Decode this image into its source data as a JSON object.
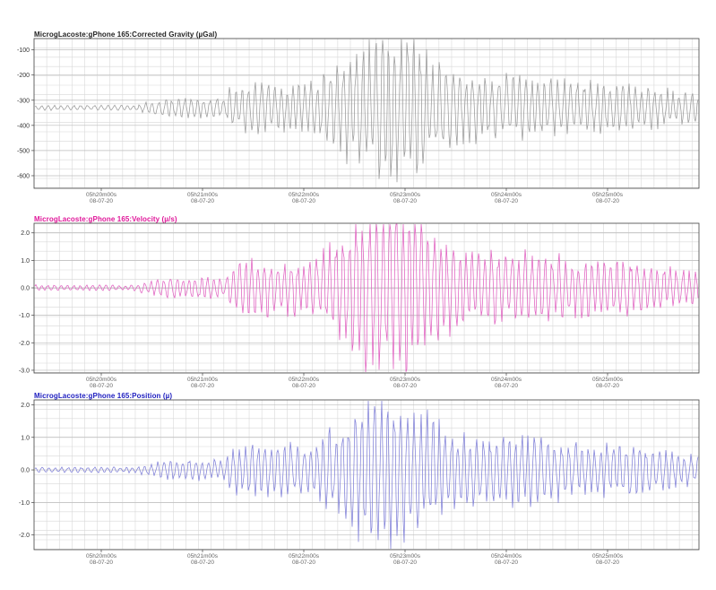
{
  "charts": [
    {
      "type": "line",
      "title": "MicrogLacoste:gPhone 165:Corrected Gravity (µGal)",
      "color": "#9a9a9a",
      "title_color": "#222222",
      "ylim": [
        -650,
        -55
      ],
      "yticks": [
        -100,
        -200,
        -300,
        -400,
        -500,
        -600
      ],
      "ytick_labels": [
        "-100",
        "-200",
        "-300",
        "-400",
        "-500",
        "-600"
      ],
      "baseline": -330,
      "amplitude_peak": 280,
      "xtick_labels": [
        [
          "05h20m00s",
          "08-07-20"
        ],
        [
          "05h21m00s",
          "08-07-20"
        ],
        [
          "05h22m00s",
          "08-07-20"
        ],
        [
          "05h23m00s",
          "08-07-20"
        ],
        [
          "05h24m00s",
          "08-07-20"
        ],
        [
          "05h25m00s",
          "08-07-20"
        ]
      ]
    },
    {
      "type": "line",
      "title": "MicrogLacoste:gPhone 165:Velocity (µ/s)",
      "color": "#e060c0",
      "title_color": "#e0189a",
      "ylim": [
        -3.1,
        2.35
      ],
      "yticks": [
        2.0,
        1.0,
        0.0,
        -1.0,
        -2.0,
        -3.0
      ],
      "ytick_labels": [
        "2.0",
        "1.0",
        "0.0",
        "-1.0",
        "-2.0",
        "-3.0"
      ],
      "baseline": 0.0,
      "amplitude_peak": 2.9,
      "xtick_labels": [
        [
          "05h20m00s",
          "08-07-20"
        ],
        [
          "05h21m00s",
          "08-07-20"
        ],
        [
          "05h22m00s",
          "08-07-20"
        ],
        [
          "05h23m00s",
          "08-07-20"
        ],
        [
          "05h24m00s",
          "08-07-20"
        ],
        [
          "05h25m00s",
          "08-07-20"
        ]
      ]
    },
    {
      "type": "line",
      "title": "MicrogLacoste:gPhone 165:Position (µ)",
      "color": "#8080d8",
      "title_color": "#2020c0",
      "ylim": [
        -2.45,
        2.15
      ],
      "yticks": [
        2.0,
        1.0,
        0.0,
        -1.0,
        -2.0
      ],
      "ytick_labels": [
        "2.0",
        "1.0",
        "0.0",
        "-1.0",
        "-2.0"
      ],
      "baseline": 0.0,
      "amplitude_peak": 2.3,
      "xtick_labels": [
        [
          "05h20m00s",
          "08-07-20"
        ],
        [
          "05h21m00s",
          "08-07-20"
        ],
        [
          "05h22m00s",
          "08-07-20"
        ],
        [
          "05h23m00s",
          "08-07-20"
        ],
        [
          "05h24m00s",
          "08-07-20"
        ],
        [
          "05h25m00s",
          "08-07-20"
        ]
      ]
    }
  ]
}
